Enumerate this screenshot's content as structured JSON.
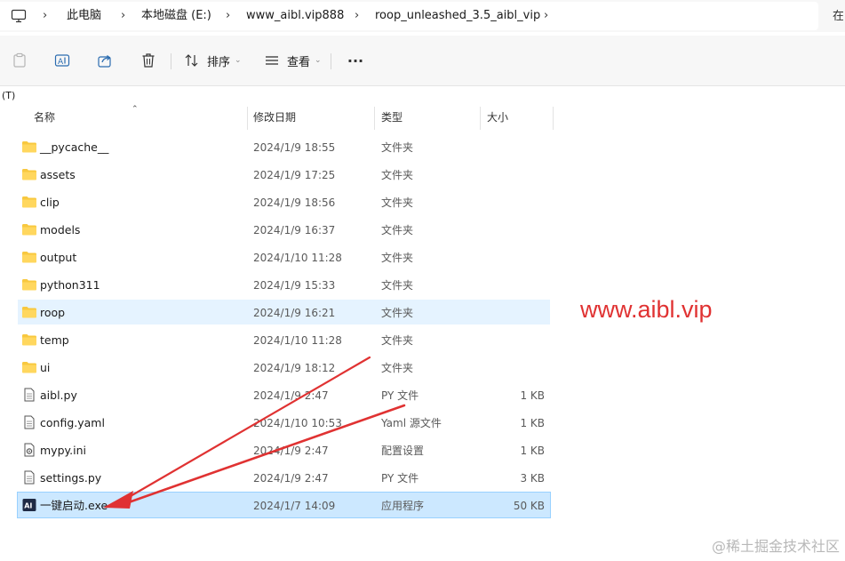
{
  "address_bar": {
    "crumbs": [
      "此电脑",
      "本地磁盘 (E:)",
      "www_aibl.vip888",
      "roop_unleashed_3.5_aibl_vip"
    ],
    "right_text": "在"
  },
  "toolbar": {
    "sort_label": "排序",
    "view_label": "查看",
    "more_label": "···"
  },
  "strip": {
    "text": "(T)"
  },
  "columns": {
    "name": "名称",
    "date": "修改日期",
    "type": "类型",
    "size": "大小"
  },
  "files": [
    {
      "name": "__pycache__",
      "date": "2024/1/9 18:55",
      "type": "文件夹",
      "size": "",
      "icon": "folder-icon"
    },
    {
      "name": "assets",
      "date": "2024/1/9 17:25",
      "type": "文件夹",
      "size": "",
      "icon": "folder-icon"
    },
    {
      "name": "clip",
      "date": "2024/1/9 18:56",
      "type": "文件夹",
      "size": "",
      "icon": "folder-icon"
    },
    {
      "name": "models",
      "date": "2024/1/9 16:37",
      "type": "文件夹",
      "size": "",
      "icon": "folder-icon"
    },
    {
      "name": "output",
      "date": "2024/1/10 11:28",
      "type": "文件夹",
      "size": "",
      "icon": "folder-icon"
    },
    {
      "name": "python311",
      "date": "2024/1/9 15:33",
      "type": "文件夹",
      "size": "",
      "icon": "folder-icon"
    },
    {
      "name": "roop",
      "date": "2024/1/9 16:21",
      "type": "文件夹",
      "size": "",
      "icon": "folder-icon"
    },
    {
      "name": "temp",
      "date": "2024/1/10 11:28",
      "type": "文件夹",
      "size": "",
      "icon": "folder-icon"
    },
    {
      "name": "ui",
      "date": "2024/1/9 18:12",
      "type": "文件夹",
      "size": "",
      "icon": "folder-icon"
    },
    {
      "name": "aibl.py",
      "date": "2024/1/9 2:47",
      "type": "PY 文件",
      "size": "1 KB",
      "icon": "document-icon"
    },
    {
      "name": "config.yaml",
      "date": "2024/1/10 10:53",
      "type": "Yaml 源文件",
      "size": "1 KB",
      "icon": "document-icon"
    },
    {
      "name": "mypy.ini",
      "date": "2024/1/9 2:47",
      "type": "配置设置",
      "size": "1 KB",
      "icon": "settings-file-icon"
    },
    {
      "name": "settings.py",
      "date": "2024/1/9 2:47",
      "type": "PY 文件",
      "size": "3 KB",
      "icon": "document-icon"
    },
    {
      "name": "一键启动.exe",
      "date": "2024/1/7 14:09",
      "type": "应用程序",
      "size": "50 KB",
      "icon": "app-icon"
    }
  ],
  "highlight": {
    "hovered_row": "roop",
    "selected_row": "一键启动.exe"
  },
  "overlays": {
    "red_watermark": "www.aibl.vip",
    "gray_watermark": "@稀土掘金技术社区"
  },
  "colors": {
    "folder": "#f8c83f",
    "hover": "#e5f3ff",
    "selected": "#cce8ff",
    "annotation_red": "#e03232"
  }
}
